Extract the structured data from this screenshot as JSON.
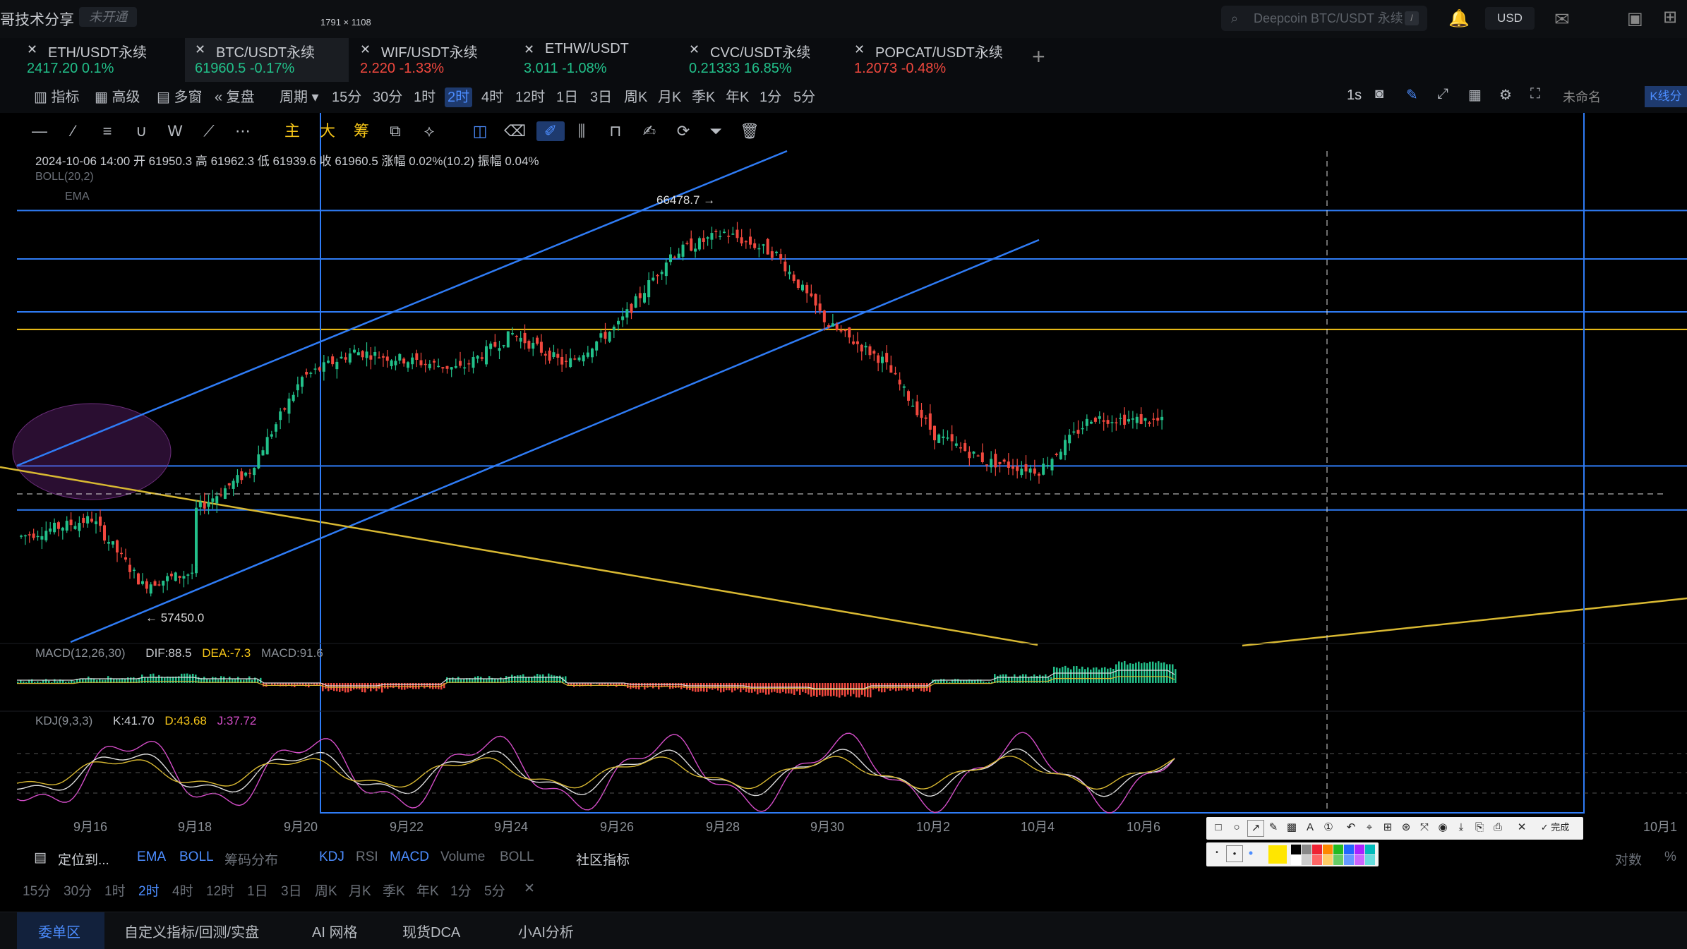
{
  "header": {
    "brand": "哥技术分享",
    "badge": "未开通",
    "search_placeholder": "Deepcoin BTC/USDT 永续",
    "search_shortcut": "/",
    "currency": "USD"
  },
  "selection_size": "1791 × 1108",
  "tabs": [
    {
      "name": "ETH/USDT永续",
      "price": "2417.20",
      "change": "0.1%",
      "dir": "up",
      "active": false
    },
    {
      "name": "BTC/USDT永续",
      "price": "61960.5",
      "change": "-0.17%",
      "dir": "up",
      "active": true
    },
    {
      "name": "WIF/USDT永续",
      "price": "2.220",
      "change": "-1.33%",
      "dir": "down",
      "active": false
    },
    {
      "name": "ETHW/USDT",
      "price": "3.011",
      "change": "-1.08%",
      "dir": "up",
      "active": false
    },
    {
      "name": "CVC/USDT永续",
      "price": "0.21333",
      "change": "16.85%",
      "dir": "up",
      "active": false
    },
    {
      "name": "POPCAT/USDT永续",
      "price": "1.2073",
      "change": "-0.48%",
      "dir": "down",
      "active": false
    }
  ],
  "toolbar": {
    "left": [
      "指标",
      "高级",
      "多窗",
      "复盘",
      "周期"
    ],
    "periods": [
      "15分",
      "30分",
      "1时",
      "2时",
      "4时",
      "12时",
      "1日",
      "3日",
      "周K",
      "月K",
      "季K",
      "年K",
      "1分",
      "5分"
    ],
    "selected_period": "2时",
    "right_interval": "1s",
    "layout_name": "未命名",
    "kline_btn": "K线分"
  },
  "drawing_labels": {
    "main": "主",
    "big": "大",
    "chips": "筹"
  },
  "ohlc": {
    "text": "2024-10-06 14:00  开 61950.3  高 61962.3  低 61939.6  收 61960.5  涨幅 0.02%(10.2)  振幅 0.04%",
    "boll": "BOLL(20,2)",
    "ema": "EMA"
  },
  "macd": {
    "label": "MACD(12,26,30)",
    "dif": "DIF:88.5",
    "dea": "DEA:-7.3",
    "macd": "MACD:91.6"
  },
  "kdj": {
    "label": "KDJ(9,3,3)",
    "k": "K:41.70",
    "d": "D:43.68",
    "j": "J:37.72"
  },
  "bottom": {
    "locate": "定位到...",
    "indicators": [
      "EMA",
      "BOLL",
      "筹码分布",
      "KDJ",
      "RSI",
      "MACD",
      "Volume",
      "BOLL"
    ],
    "community": "社区指标",
    "periods": [
      "15分",
      "30分",
      "1时",
      "2时",
      "4时",
      "12时",
      "1日",
      "3日",
      "周K",
      "月K",
      "季K",
      "年K",
      "1分",
      "5分"
    ],
    "selected_period": "2时",
    "log_label": "对数",
    "pct_label": "%",
    "tabs": [
      "委单区",
      "自定义指标/回测/实盘",
      "AI 网格",
      "现货DCA",
      "小AI分析"
    ]
  },
  "palette": {
    "done": "完成"
  },
  "colors": {
    "up": "#22c08a",
    "down": "#f0483e",
    "trendline": "#2f7cf6",
    "yellow": "#f5c518",
    "accent": "#4c8dff"
  },
  "chart_data": {
    "type": "candlestick",
    "title": "",
    "x_tick_labels": [
      "9月16",
      "9月18",
      "9月20",
      "9月22",
      "9月24",
      "9月26",
      "9月28",
      "9月30",
      "10月2",
      "10月4",
      "10月6",
      "10月1"
    ],
    "annotations": [
      {
        "label": "66478.7",
        "kind": "high"
      },
      {
        "label": "57450.0",
        "kind": "low"
      }
    ],
    "price_path": [
      [
        "9月15",
        59400
      ],
      [
        "9月16",
        59800
      ],
      [
        "9月17",
        58300
      ],
      [
        "9月18",
        58600
      ],
      [
        "9月18",
        60000
      ],
      [
        "9月19",
        60900
      ],
      [
        "9月20",
        63000
      ],
      [
        "9月21",
        63600
      ],
      [
        "9月22",
        63400
      ],
      [
        "9月23",
        63200
      ],
      [
        "9月24",
        64000
      ],
      [
        "9月25",
        63300
      ],
      [
        "9月26",
        64200
      ],
      [
        "9月27",
        65800
      ],
      [
        "9月28",
        66300
      ],
      [
        "9月29",
        65800
      ],
      [
        "9月30",
        64200
      ],
      [
        "10月1",
        63400
      ],
      [
        "10月2",
        61700
      ],
      [
        "10月3",
        61100
      ],
      [
        "10月4",
        60900
      ],
      [
        "10月5",
        62100
      ],
      [
        "10月6",
        62000
      ]
    ],
    "horizontal_levels": [
      66800,
      65700,
      64500,
      64100,
      61000,
      60000
    ],
    "macd_hist": [
      0.1,
      0.2,
      0.3,
      0.2,
      -0.1,
      -0.3,
      -0.2,
      0.2,
      0.3,
      -0.1,
      -0.2,
      -0.3,
      -0.4,
      -0.5,
      -0.3,
      0.1,
      0.3,
      0.6,
      0.8,
      0.5
    ]
  }
}
